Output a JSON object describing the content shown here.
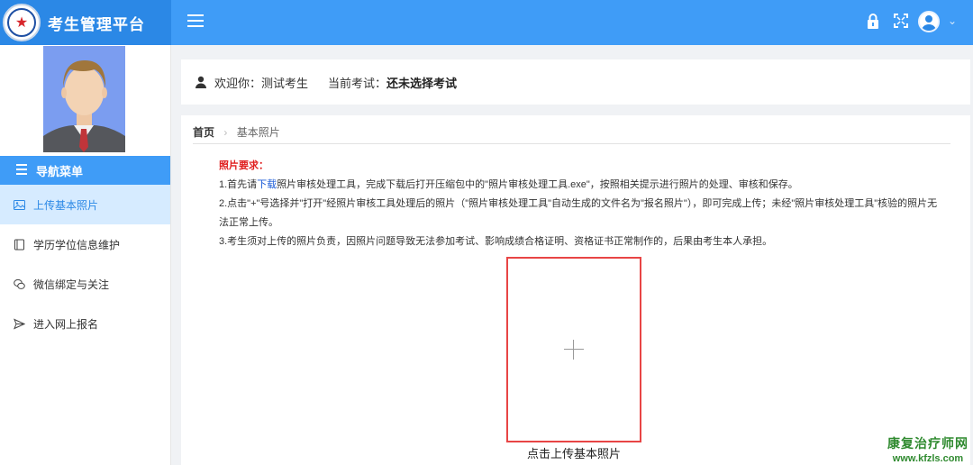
{
  "app": {
    "title": "考生管理平台"
  },
  "header": {
    "icons": [
      "menu-icon",
      "lock-icon",
      "fullscreen-icon",
      "user-avatar-icon",
      "chevron-down-icon"
    ]
  },
  "sidebar": {
    "menu_title": "导航菜单",
    "items": [
      {
        "label": "上传基本照片",
        "icon": "image-icon",
        "active": true
      },
      {
        "label": "学历学位信息维护",
        "icon": "book-icon",
        "active": false
      },
      {
        "label": "微信绑定与关注",
        "icon": "wechat-icon",
        "active": false
      },
      {
        "label": "进入网上报名",
        "icon": "send-icon",
        "active": false
      }
    ]
  },
  "welcome": {
    "greeting": "欢迎你：测试考生",
    "exam_label": "当前考试：",
    "exam_value": "还未选择考试"
  },
  "breadcrumb": {
    "home": "首页",
    "current": "基本照片"
  },
  "requirements": {
    "title": "照片要求：",
    "line1_prefix": "1.首先请",
    "line1_link": "下载",
    "line1_suffix": "照片审核处理工具，完成下载后打开压缩包中的\"照片审核处理工具.exe\"，按照相关提示进行照片的处理、审核和保存。",
    "line2": "2.点击\"+\"号选择并\"打开\"经照片审核工具处理后的照片（\"照片审核处理工具\"自动生成的文件名为\"报名照片\"），即可完成上传；未经\"照片审核处理工具\"核验的照片无法正常上传。",
    "line3": "3.考生须对上传的照片负责，因照片问题导致无法参加考试、影响成绩合格证明、资格证书正常制作的，后果由考生本人承担。"
  },
  "upload": {
    "caption": "点击上传基本照片"
  },
  "watermark": {
    "line1": "康复治疗师网",
    "line2": "www.kfzls.com"
  },
  "colors": {
    "header_bg": "#3f9cf7",
    "brand_bg": "#2b88e6",
    "active_item_bg": "#d6ebff",
    "requirement_title": "#e02020",
    "link": "#1a5ad6",
    "upload_border": "#e84545"
  }
}
